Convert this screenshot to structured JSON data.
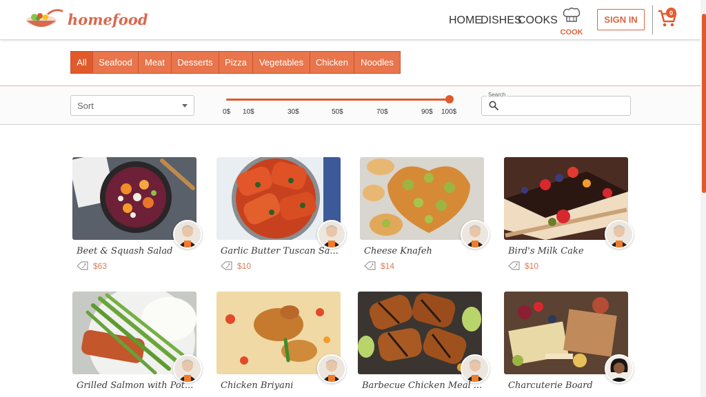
{
  "brand": {
    "name": "homefood"
  },
  "nav": {
    "home": "HOME",
    "dishes": "DISHES",
    "cooks": "COOKS",
    "cook": "COOK",
    "sign_in": "SIGN IN",
    "cart_count": "0"
  },
  "categories": [
    "All",
    "Seafood",
    "Meat",
    "Desserts",
    "Pizza",
    "Vegetables",
    "Chicken",
    "Noodles"
  ],
  "active_category": "All",
  "filters": {
    "sort_placeholder": "Sort",
    "price_ticks": [
      "0$",
      "10$",
      "30$",
      "50$",
      "70$",
      "90$",
      "100$"
    ],
    "price_range": [
      0,
      100
    ],
    "search_label": "Search",
    "search_value": ""
  },
  "dishes": [
    {
      "name": "Beet & Squash Salad",
      "price": "$63"
    },
    {
      "name": "Garlic Butter Tuscan Sa...",
      "price": "$10"
    },
    {
      "name": "Cheese Knafeh",
      "price": "$14"
    },
    {
      "name": "Bird's Milk Cake",
      "price": "$10"
    },
    {
      "name": "Grilled Salmon with Pot...",
      "price": ""
    },
    {
      "name": "Chicken Briyani",
      "price": ""
    },
    {
      "name": "Barbecue Chicken Meal ...",
      "price": ""
    },
    {
      "name": "Charcuterie Board",
      "price": ""
    }
  ],
  "colors": {
    "accent": "#e05a2b",
    "category_bg": "#e8754c",
    "price": "#e07a52",
    "nav": "#d9663f"
  },
  "icons": [
    "logo-bowl-icon",
    "chef-hat-icon",
    "cart-icon",
    "chevron-down-icon",
    "search-icon",
    "price-tag-icon"
  ]
}
